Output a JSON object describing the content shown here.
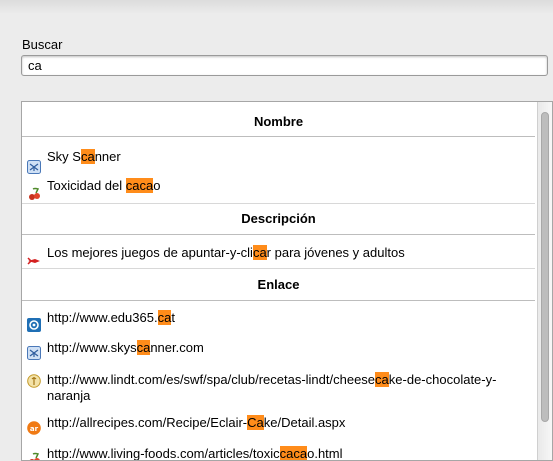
{
  "search": {
    "label": "Buscar",
    "value": "ca"
  },
  "sections": {
    "name_header": "Nombre",
    "desc_header": "Descripción",
    "link_header": "Enlace"
  },
  "name_results": [
    {
      "pre": "Sky S",
      "match": "ca",
      "post": "nner",
      "icon": "sky-scanner-icon"
    },
    {
      "pre": "Toxicidad del ",
      "match": "caca",
      "post": "o",
      "icon": "cherry-icon"
    }
  ],
  "desc_results": [
    {
      "pre": "Los mejores juegos de apuntar-y-cli",
      "match": "ca",
      "post": "r para jóvenes y adultos",
      "icon": "red-dart-icon"
    }
  ],
  "link_results": [
    {
      "pre": "http://www.edu365.",
      "match": "ca",
      "post": "t",
      "icon": "edu365-icon"
    },
    {
      "pre": "http://www.skys",
      "match": "ca",
      "post": "nner.com",
      "icon": "sky-scanner-icon"
    },
    {
      "pre": "http://www.lindt.com/es/swf/spa/club/recetas-lindt/cheese",
      "match": "ca",
      "post": "ke-de-chocolate-y-",
      "line2": "naranja",
      "icon": "lindt-icon"
    },
    {
      "pre": "http://allrecipes.com/Recipe/Eclair-",
      "match": "Ca",
      "post": "ke/Detail.aspx",
      "icon": "allrecipes-icon"
    },
    {
      "pre": "http://www.living-foods.com/articles/toxic",
      "match": "caca",
      "post": "o.html",
      "icon": "cherry-icon"
    }
  ]
}
